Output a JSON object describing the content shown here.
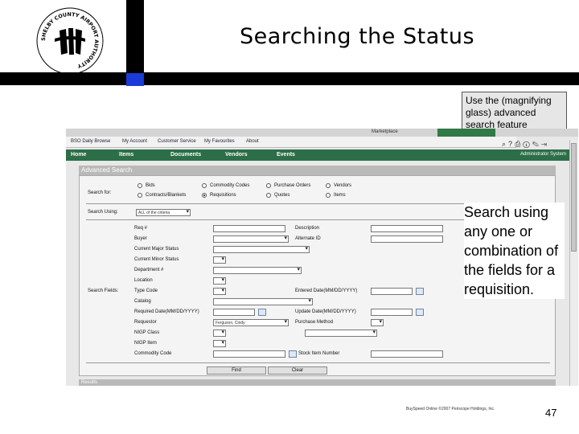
{
  "slide": {
    "title": "Searching the Status",
    "callout": "Use the (magnifying glass) advanced search feature",
    "body": "Search using any one or combination of the fields for a requisition.",
    "footer": "BuySpeed Online ©2007 Periscope Holdings, Inc.",
    "page_number": "47",
    "logo_text": "SHELBY COUNTY AIRPORT AUTHORITY"
  },
  "app": {
    "links": [
      "BSO Daily Browse",
      "My Account",
      "Customer Service",
      "My Favourites",
      "About"
    ],
    "top_tab": "Marketplace",
    "nav": [
      "Home",
      "Items",
      "Documents",
      "Vendors",
      "Events"
    ],
    "admin_label": "Administrator System",
    "icons": [
      "magnifier-icon",
      "help-icon",
      "print-icon",
      "info-icon",
      "edit-icon",
      "exit-icon"
    ],
    "header": "Advanced Search",
    "search_for_label": "Search for:",
    "search_for_options": [
      {
        "label": "Bids",
        "selected": false
      },
      {
        "label": "Commodity Codes",
        "selected": false
      },
      {
        "label": "Purchase Orders",
        "selected": false
      },
      {
        "label": "Vendors",
        "selected": false
      },
      {
        "label": "Contracts/Blankets",
        "selected": false
      },
      {
        "label": "Requisitions",
        "selected": true
      },
      {
        "label": "Quotes",
        "selected": false
      },
      {
        "label": "Items",
        "selected": false
      }
    ],
    "search_using_label": "Search Using:",
    "search_using_value": "ALL of the criteria",
    "search_fields_label": "Search Fields:",
    "fields_left": [
      "Req #",
      "Buyer",
      "Current Major Status",
      "Current Minor Status",
      "Department #",
      "Location",
      "Type Code",
      "Catalog",
      "Required Date(MM/DD/YYYY)",
      "Requestor",
      "NIGP Class",
      "NIGP Item",
      "Commodity Code"
    ],
    "fields_right": [
      "Description",
      "Alternate ID",
      "Entered Date(MM/DD/YYYY)",
      "Update Date(MM/DD/YYYY)",
      "Purchase Method",
      "Stock Item Number"
    ],
    "requestor_value": "Ferguson, Cindy",
    "find_button": "Find",
    "clear_button": "Clear",
    "results_label": "Results"
  }
}
